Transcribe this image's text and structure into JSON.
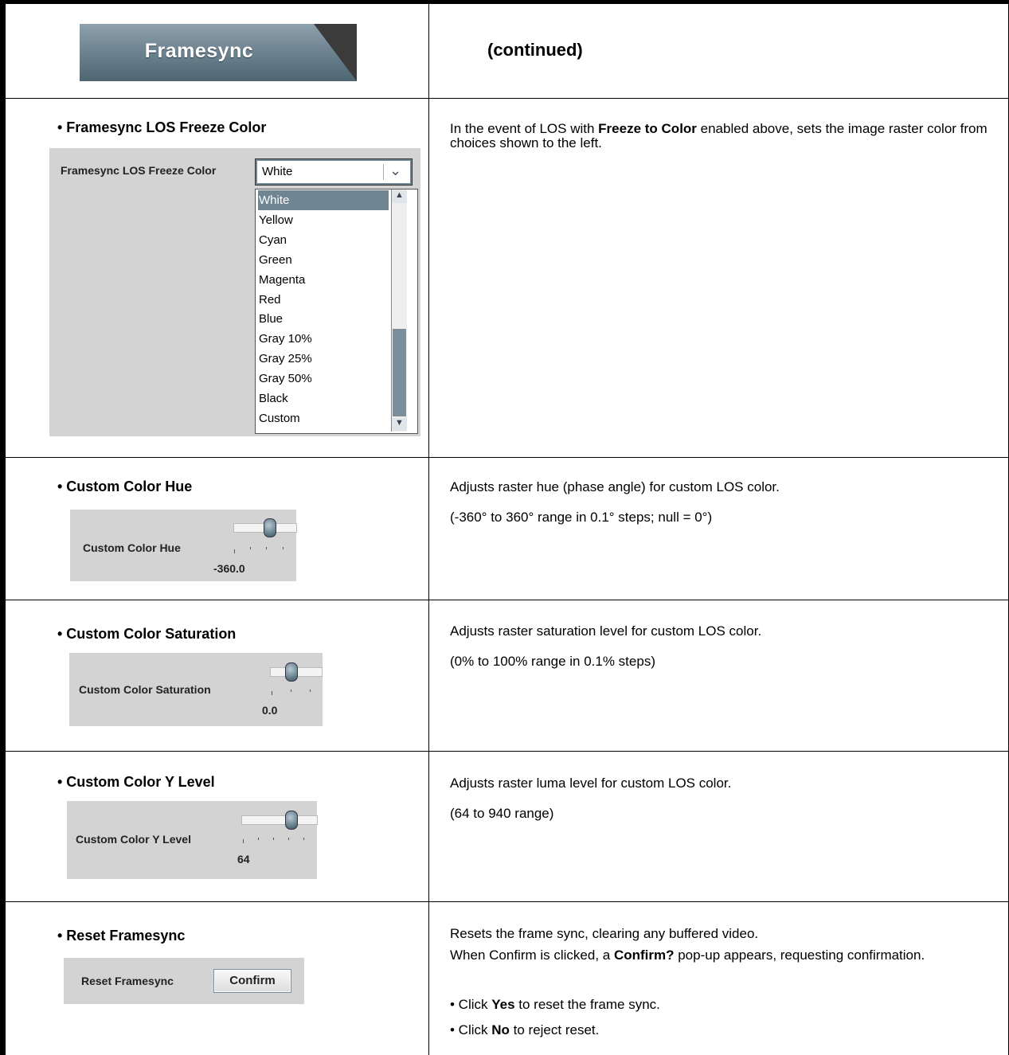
{
  "header": {
    "tab_label": "Framesync",
    "continued": "(continued)"
  },
  "rows": [
    {
      "heading": "• Framesync LOS Freeze Color",
      "control_label": "Framesync LOS Freeze Color",
      "selected_value": "White",
      "options": [
        "White",
        "Yellow",
        "Cyan",
        "Green",
        "Magenta",
        "Red",
        "Blue",
        "Gray 10%",
        "Gray 25%",
        "Gray 50%",
        "Black",
        "Custom"
      ],
      "desc_a": "In the event of LOS with ",
      "desc_b": "Freeze to Color",
      "desc_c": " enabled above, sets the image raster color from choices shown to the left."
    },
    {
      "heading": "• Custom Color Hue",
      "control_label": "Custom Color Hue",
      "value": "-360.0",
      "desc_1": "Adjusts raster hue (phase angle) for custom LOS color.",
      "desc_2": "(-360° to 360° range in 0.1° steps; null = 0°)"
    },
    {
      "heading": "• Custom Color Saturation",
      "control_label": "Custom Color Saturation",
      "value": "0.0",
      "desc_1": "Adjusts raster saturation level for custom LOS color.",
      "desc_2": "(0% to 100% range in 0.1% steps)"
    },
    {
      "heading": "• Custom Color Y Level",
      "control_label": "Custom Color Y Level",
      "value": "64",
      "desc_1": "Adjusts raster luma level for custom LOS color.",
      "desc_2": "(64 to 940 range)"
    },
    {
      "heading": "• Reset Framesync",
      "control_label": "Reset Framesync",
      "button_label": "Confirm",
      "desc_1": "Resets the frame sync, clearing any buffered video.",
      "desc_2a": "When Confirm is clicked, a ",
      "desc_2b": "Confirm?",
      "desc_2c": " pop-up appears, requesting confirmation.",
      "bullet1_a": "• Click ",
      "bullet1_b": "Yes",
      "bullet1_c": " to reset the frame sync.",
      "bullet2_a": "• Click ",
      "bullet2_b": "No",
      "bullet2_c": " to reject reset."
    }
  ],
  "colors": {
    "accent": "#6f8591",
    "panel": "#d3d3d3"
  }
}
